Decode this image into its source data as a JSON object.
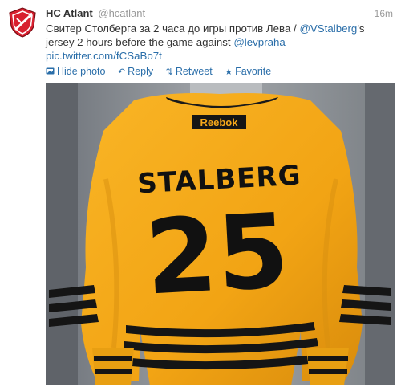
{
  "tweet": {
    "author_name": "HC Atlant",
    "author_handle": "@hcatlant",
    "timestamp": "16m",
    "text_part1": "Свитер Столберга за 2 часа до игры против Лева / ",
    "mention1": "@VStalberg",
    "text_part2": "'s jersey 2 hours before the game against ",
    "mention2": "@levpraha",
    "link": "pic.twitter.com/fCSaBo7t"
  },
  "actions": {
    "hide_photo": "Hide photo",
    "reply": "Reply",
    "retweet": "Retweet",
    "favorite": "Favorite"
  },
  "photo": {
    "brand": "Reebok",
    "player_name": "STALBERG",
    "number": "25"
  },
  "icons": {
    "avatar": "hc-atlant-logo-icon",
    "hide_photo": "photo-icon",
    "reply": "reply-icon",
    "retweet": "retweet-icon",
    "favorite": "star-icon"
  },
  "colors": {
    "link": "#2a6ea9",
    "jersey": "#f6ab18",
    "stripe": "#141414",
    "avatar_red": "#d8202f"
  }
}
